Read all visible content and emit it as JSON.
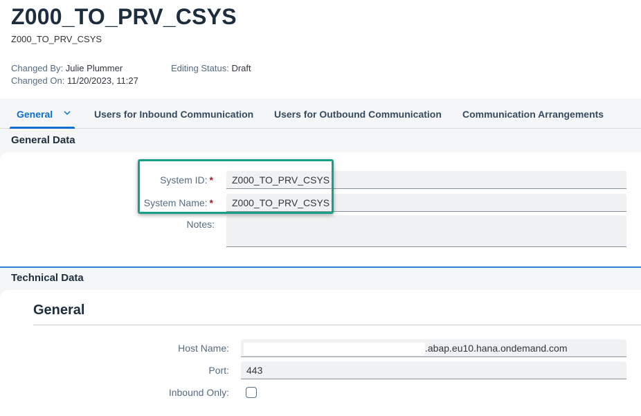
{
  "header": {
    "title": "Z000_TO_PRV_CSYS",
    "subtitle": "Z000_TO_PRV_CSYS",
    "changed_by_label": "Changed By:",
    "changed_by_value": "Julie Plummer",
    "changed_on_label": "Changed On:",
    "changed_on_value": "11/20/2023, 11:27",
    "editing_status_label": "Editing Status:",
    "editing_status_value": "Draft"
  },
  "tabs": [
    {
      "label": "General",
      "selected": true
    },
    {
      "label": "Users for Inbound Communication"
    },
    {
      "label": "Users for Outbound Communication"
    },
    {
      "label": "Communication Arrangements"
    }
  ],
  "general_data": {
    "section_title": "General Data",
    "system_id_label": "System ID:",
    "system_id_value": "Z000_TO_PRV_CSYS",
    "system_name_label": "System Name:",
    "system_name_value": "Z000_TO_PRV_CSYS",
    "notes_label": "Notes:",
    "notes_value": "",
    "required_marker": "*"
  },
  "technical_data": {
    "section_title": "Technical Data",
    "group_title": "General",
    "host_name_label": "Host Name:",
    "host_name_value": ".abap.eu10.hana.ondemand.com",
    "port_label": "Port:",
    "port_value": "443",
    "inbound_only_label": "Inbound Only:",
    "inbound_only_checked": false
  },
  "colors": {
    "accent": "#0a6ed1",
    "highlight_box": "#16a085",
    "required": "#a51c30"
  }
}
